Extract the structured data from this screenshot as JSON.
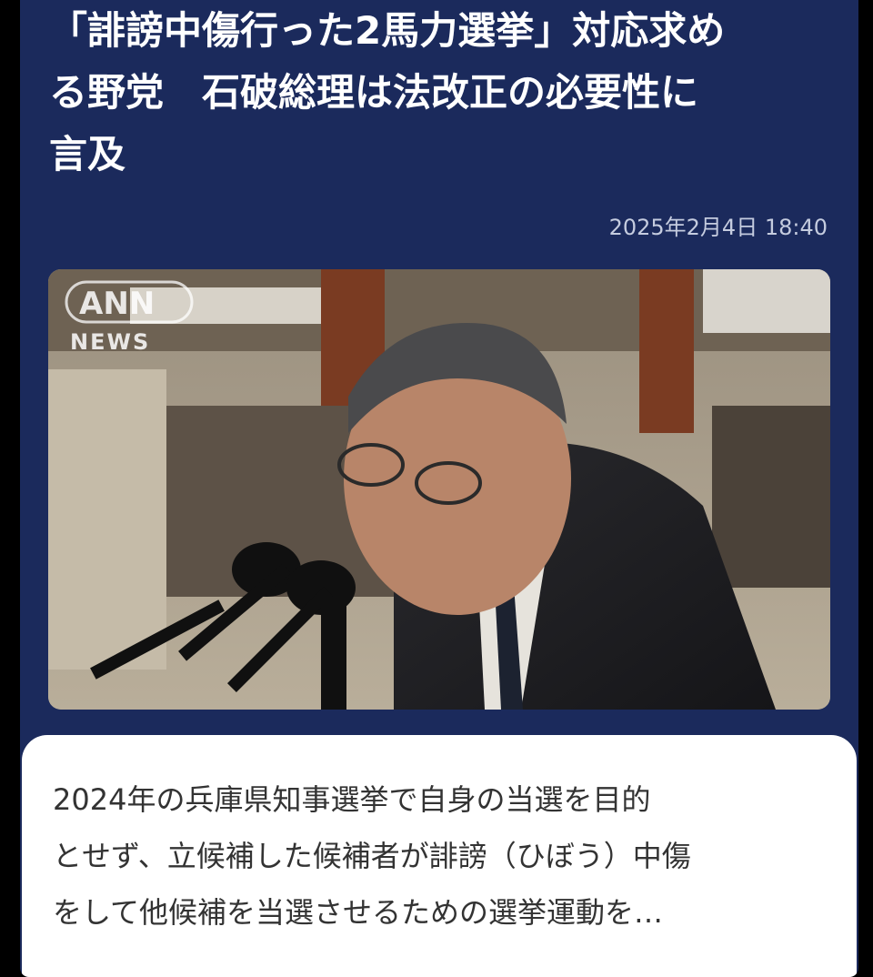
{
  "article": {
    "title_lines": [
      "「誹謗中傷行った2馬力選挙」対応求め",
      "る野党　石破総理は法改正の必要性に",
      "言及"
    ],
    "timestamp": "2025年2月4日 18:40",
    "image": {
      "source_logo": "ANN",
      "source_label": "NEWS"
    },
    "summary_lines": [
      "2024年の兵庫県知事選挙で自身の当選を目的",
      "とせず、立候補した候補者が誹謗（ひぼう）中傷",
      "をして他候補を当選させるための選挙運動を…"
    ]
  },
  "colors": {
    "card_background": "#1b2a5c",
    "title_text": "#ffffff",
    "timestamp_text": "#c5ccdf",
    "summary_background": "#ffffff",
    "summary_text": "#333333"
  }
}
